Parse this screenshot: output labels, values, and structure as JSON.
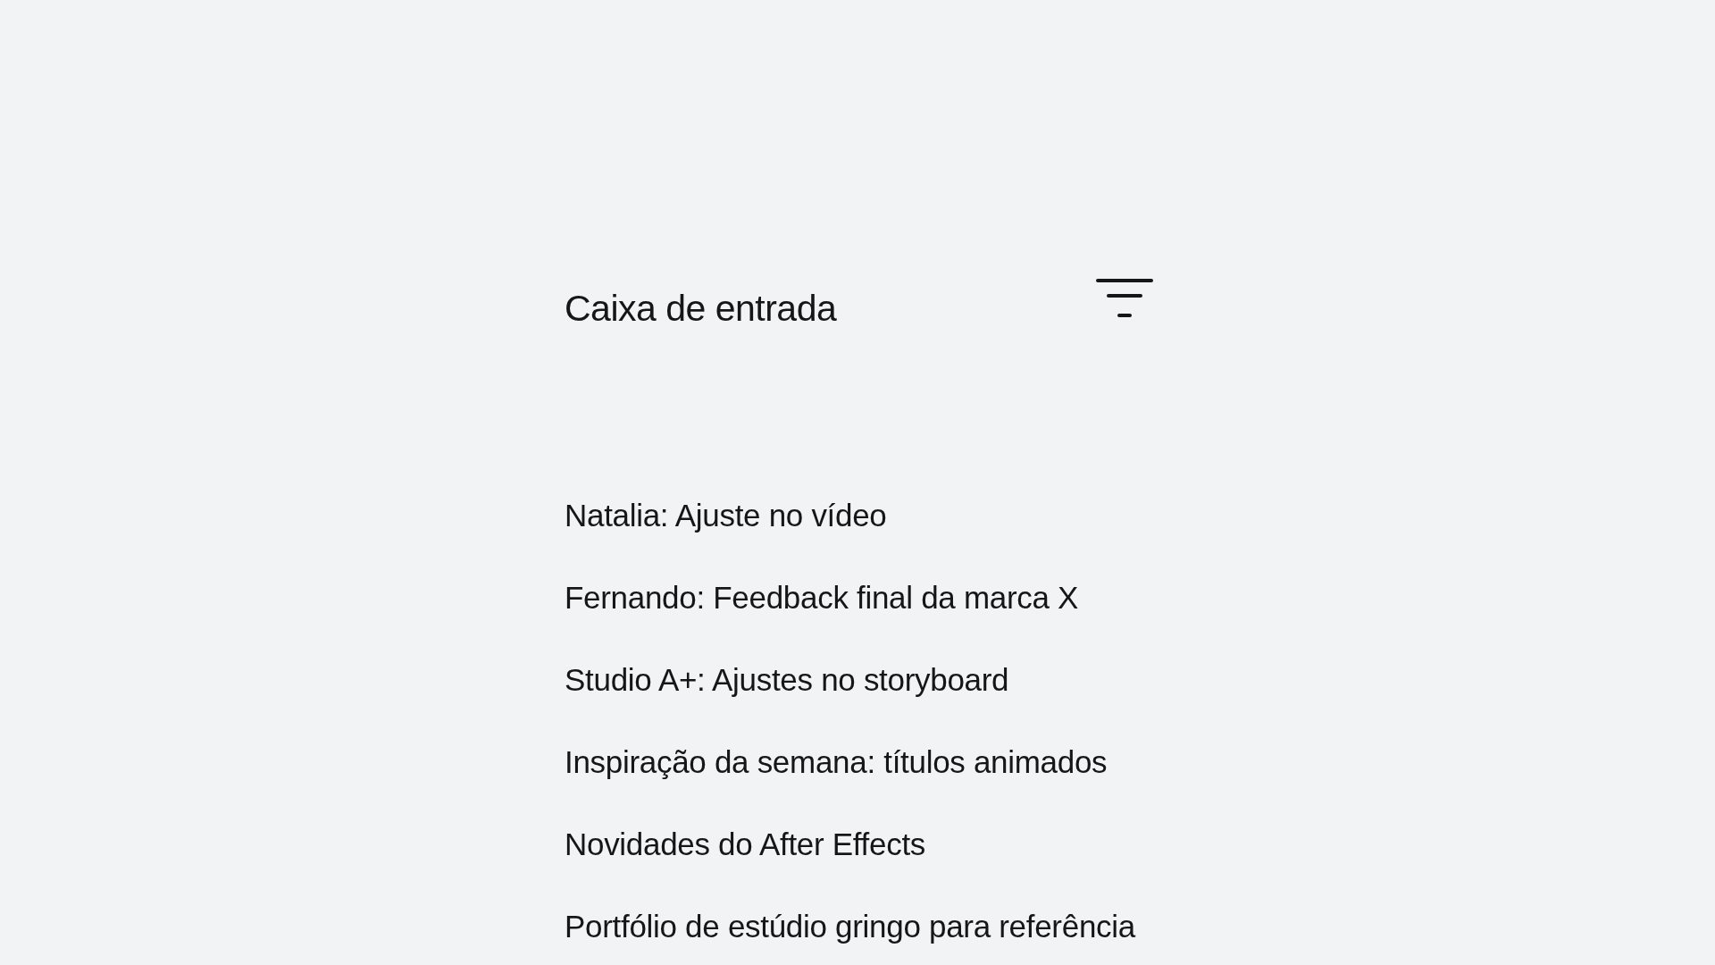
{
  "header": {
    "title": "Caixa de entrada"
  },
  "messages": [
    "Natalia: Ajuste no vídeo",
    "Fernando: Feedback final da marca X",
    "Studio A+: Ajustes no storyboard",
    "Inspiração da semana: títulos animados",
    "Novidades do After Effects",
    "Portfólio de estúdio gringo para referência"
  ]
}
